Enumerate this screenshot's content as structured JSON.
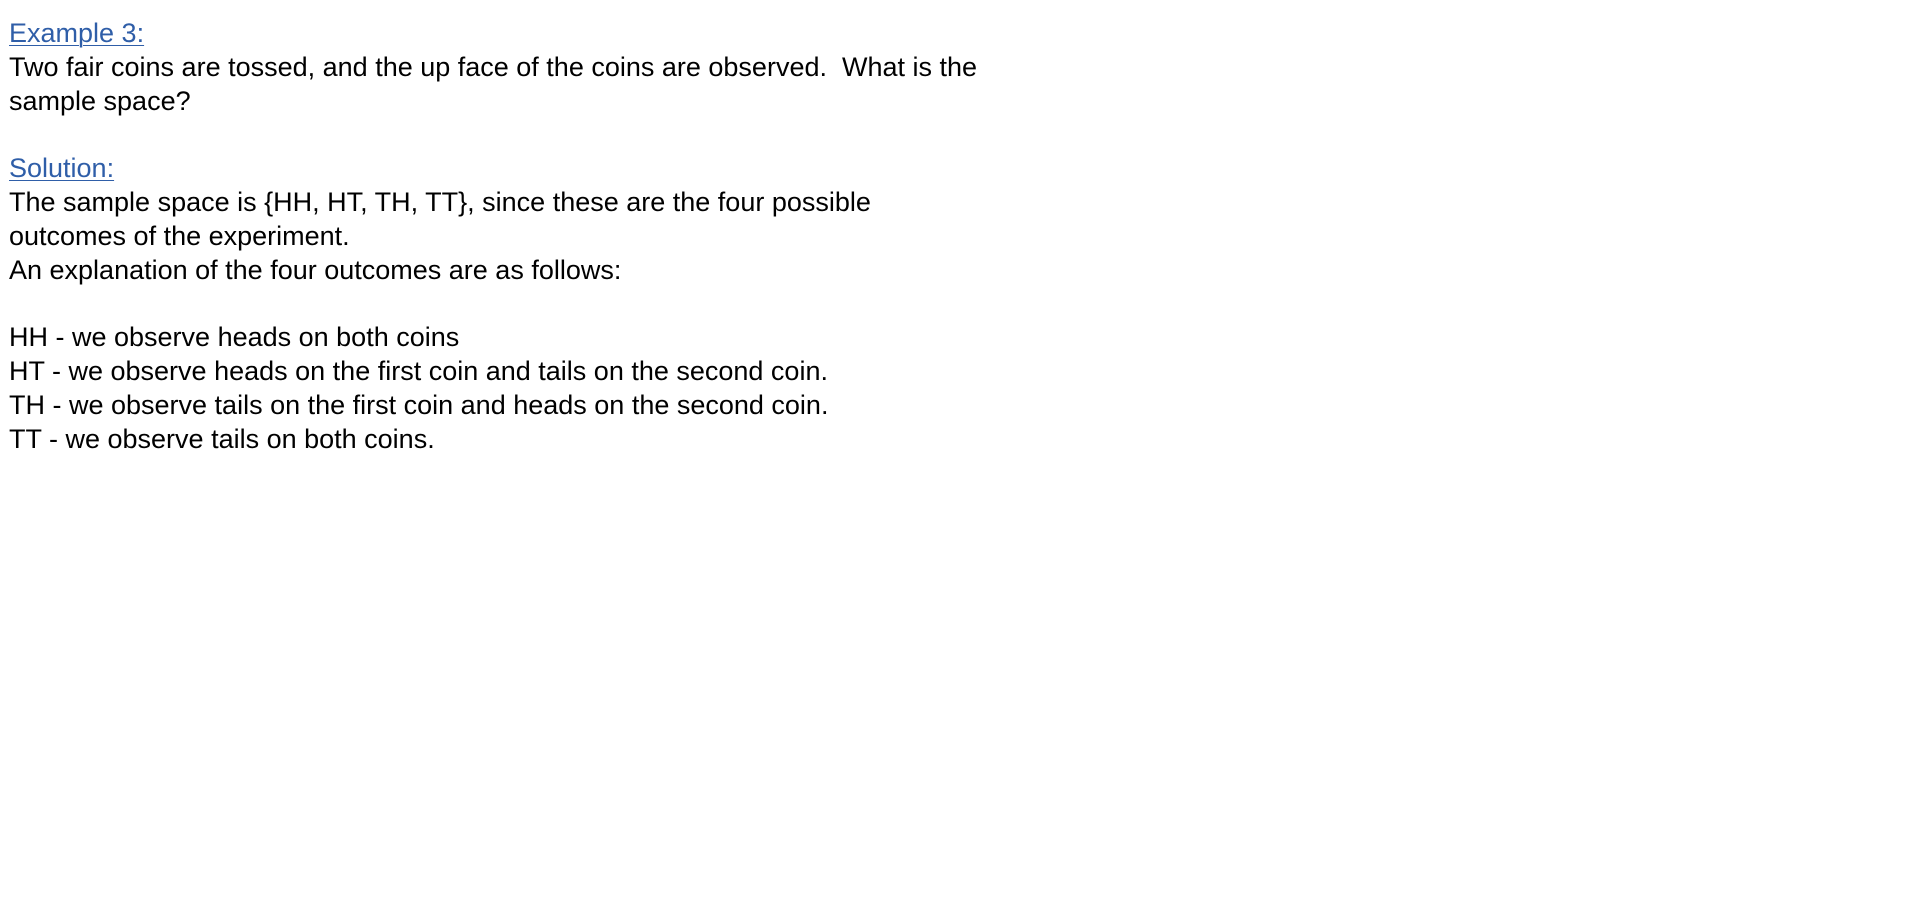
{
  "example": {
    "heading": "Example 3:",
    "question_lines": [
      "Two fair coins are tossed, and the up face of the coins are observed.  What is the",
      "sample space?"
    ]
  },
  "solution": {
    "heading": "Solution:",
    "body_lines": [
      "The sample space is {HH, HT, TH, TT}, since these are the four possible",
      "outcomes of the experiment.",
      "An explanation of the four outcomes are as follows:"
    ],
    "outcomes": [
      "HH - we observe heads on both coins",
      "HT - we observe heads on the first coin and tails on the second coin.",
      "TH - we observe tails on the first coin and heads on the second coin.",
      "TT - we observe tails on both coins."
    ]
  },
  "colors": {
    "heading_link": "#2f5ea8",
    "text": "#000000",
    "background": "#ffffff"
  }
}
